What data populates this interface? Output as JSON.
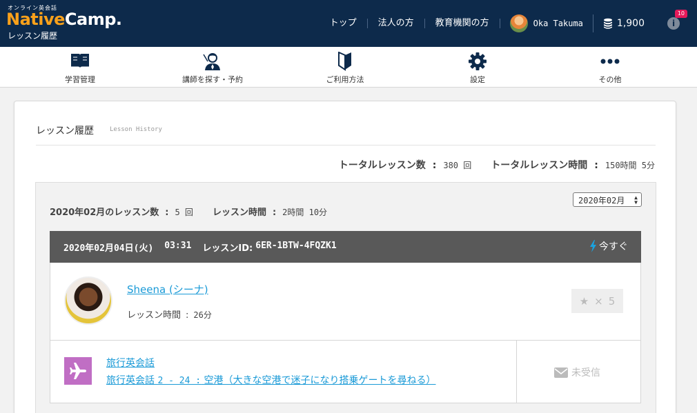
{
  "header": {
    "logo_sub": "オンライン英会話",
    "logo_native": "Native",
    "logo_camp": "Camp.",
    "page_name": "レッスン履歴",
    "links": [
      "トップ",
      "法人の方",
      "教育機関の方"
    ],
    "user_name": "Oka Takuma",
    "coins": "1,900",
    "notif_count": "10"
  },
  "mainnav": {
    "items": [
      {
        "label": "学習管理",
        "icon": "book-icon"
      },
      {
        "label": "講師を探す・予約",
        "icon": "teacher-icon"
      },
      {
        "label": "ご利用方法",
        "icon": "beginner-mark-icon"
      },
      {
        "label": "設定",
        "icon": "gear-icon"
      },
      {
        "label": "その他",
        "icon": "more-icon"
      }
    ]
  },
  "page": {
    "title": "レッスン履歴",
    "title_en": "Lesson History",
    "total_lessons_label": "トータルレッスン数",
    "total_lessons_value": "380 回",
    "total_time_label": "トータルレッスン時間",
    "total_time_value": "150時間 5分"
  },
  "month": {
    "lessons_label": "2020年02月のレッスン数",
    "lessons_value": "5 回",
    "time_label": "レッスン時間",
    "time_value": "2時間 10分",
    "selected": "2020年02月"
  },
  "lesson": {
    "date": "2020年02月04日(火)",
    "time": "03:31",
    "id_label": "レッスンID:",
    "id_value": "6ER-1BTW-4FQZK1",
    "now_label": "今すぐ",
    "tutor_name": "Sheena (シーナ)",
    "duration_label": "レッスン時間",
    "duration_value": "26分",
    "fav_x": "×",
    "fav_count": "5",
    "material_category": "旅行英会話",
    "material_title_prefix": "旅行英会話 ",
    "material_title_num": "2 - 24 :",
    "material_title_rest": " 空港（大きな空港で迷子になり搭乗ゲートを尋ねる）",
    "feedback_status": "未受信"
  },
  "colors": {
    "header_bg": "#0d2a4b",
    "logo_orange": "#f9a11b",
    "link_blue": "#1a9ad7",
    "lesson_head_bg": "#595959",
    "material_icon_bg": "#c06ec4",
    "badge_pink": "#e5195a"
  }
}
